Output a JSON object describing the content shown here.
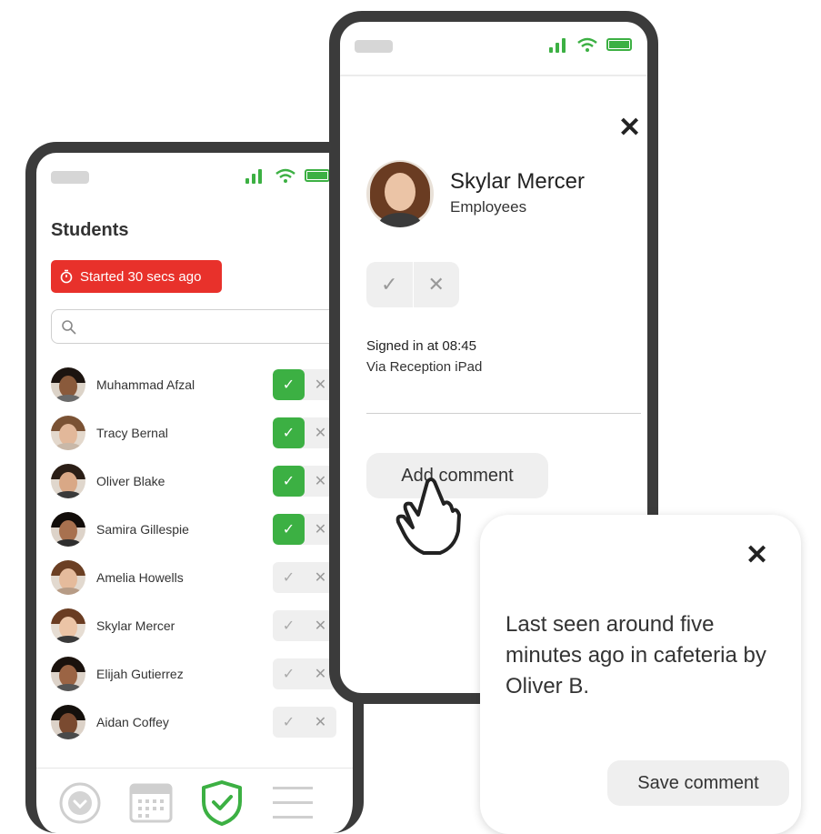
{
  "students_screen": {
    "title": "Students",
    "timer_label": "Started 30 secs ago",
    "search": {
      "placeholder": ""
    },
    "students": [
      {
        "name": "Muhammad Afzal",
        "present": true
      },
      {
        "name": "Tracy Bernal",
        "present": true
      },
      {
        "name": "Oliver Blake",
        "present": true
      },
      {
        "name": "Samira Gillespie",
        "present": true
      },
      {
        "name": "Amelia Howells",
        "present": false
      },
      {
        "name": "Skylar Mercer",
        "present": false
      },
      {
        "name": "Elijah Gutierrez",
        "present": false
      },
      {
        "name": "Aidan Coffey",
        "present": false
      }
    ],
    "tabbar": [
      "chevron-down-icon",
      "calendar-icon",
      "shield-check-icon",
      "menu-icon"
    ]
  },
  "detail_screen": {
    "person_name": "Skylar Mercer",
    "person_role": "Employees",
    "signed_in": "Signed in at 08:45",
    "via": "Via Reception iPad",
    "add_comment_label": "Add comment"
  },
  "comment_card": {
    "text": "Last seen around five minutes ago in cafeteria by Oliver B.",
    "save_label": "Save comment"
  },
  "colors": {
    "accent_green": "#3cb043",
    "alert_red": "#e8312b",
    "frame": "#3b3b3b"
  }
}
